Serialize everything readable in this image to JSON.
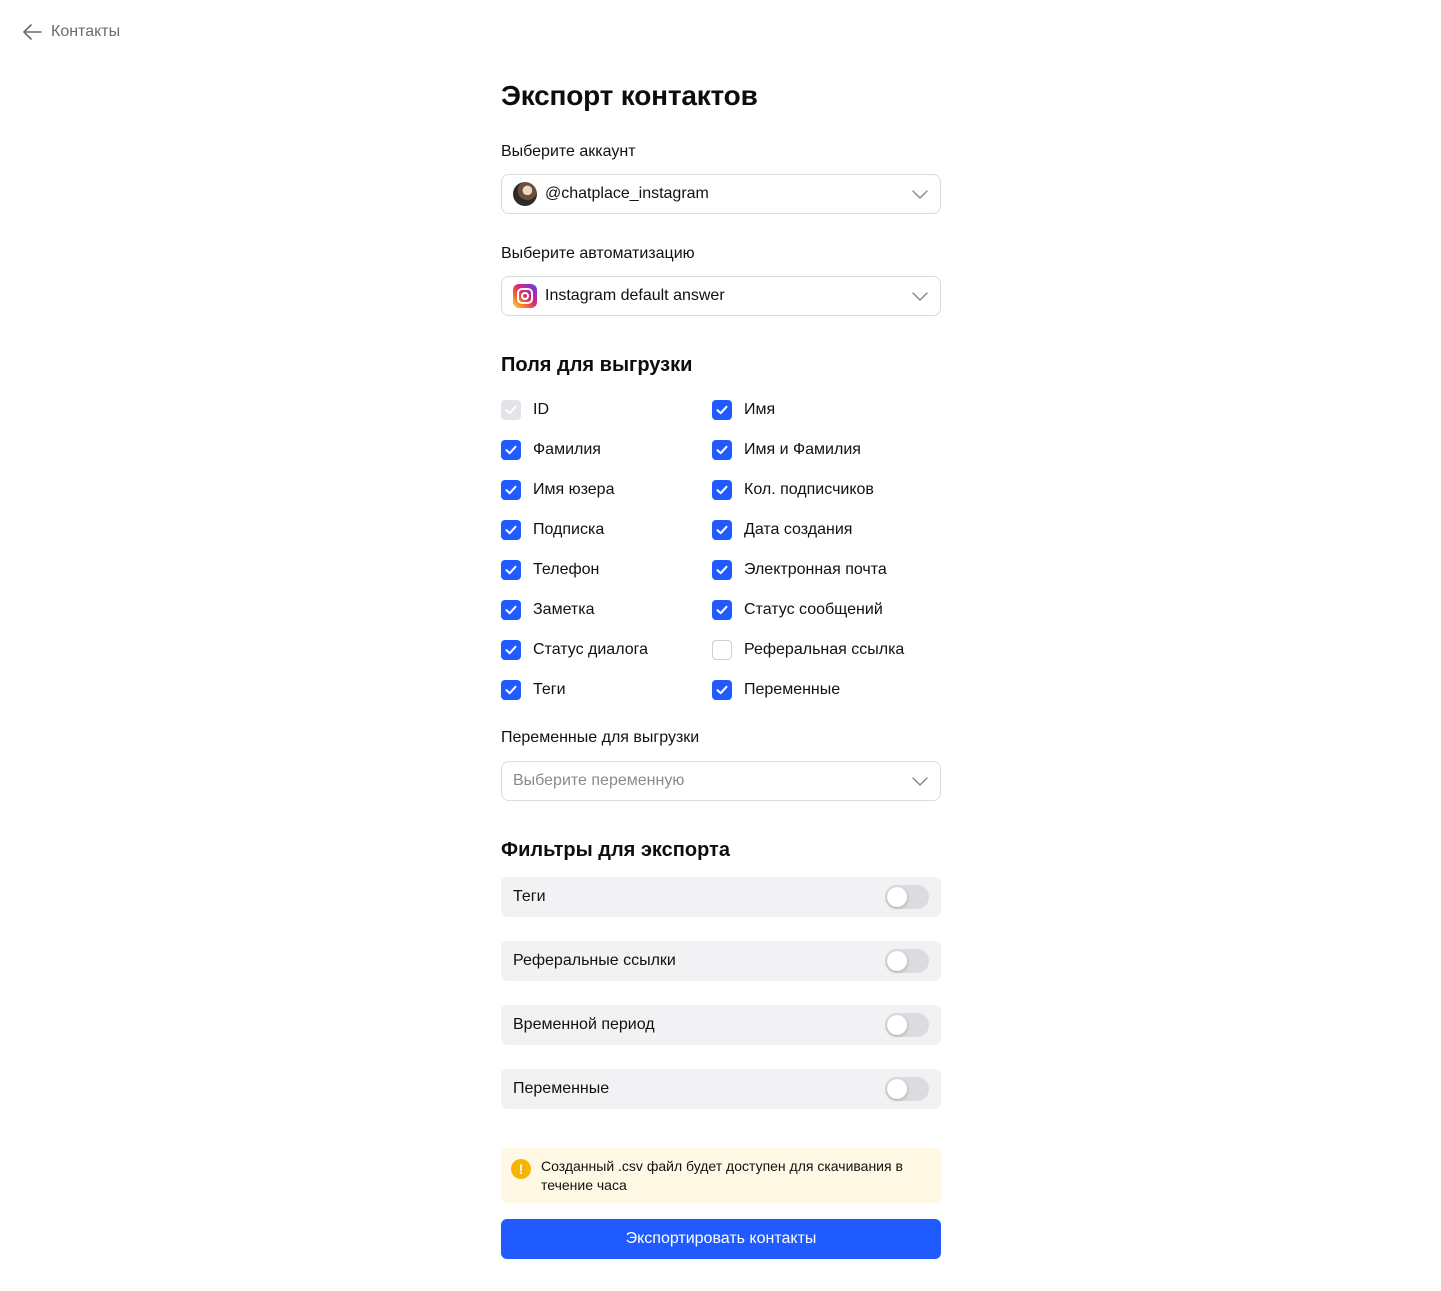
{
  "back": {
    "label": "Контакты",
    "icon": "arrow-left-icon"
  },
  "title": "Экспорт контактов",
  "account": {
    "label": "Выберите аккаунт",
    "value": "@chatplace_instagram",
    "icon": "avatar"
  },
  "automation": {
    "label": "Выберите автоматизацию",
    "value": "Instagram default answer",
    "icon": "instagram-icon"
  },
  "fields": {
    "title": "Поля для выгрузки",
    "items": [
      {
        "label": "ID",
        "state": "disabled"
      },
      {
        "label": "Имя",
        "state": "checked"
      },
      {
        "label": "Фамилия",
        "state": "checked"
      },
      {
        "label": "Имя и Фамилия",
        "state": "checked"
      },
      {
        "label": "Имя юзера",
        "state": "checked"
      },
      {
        "label": "Кол. подписчиков",
        "state": "checked"
      },
      {
        "label": "Подписка",
        "state": "checked"
      },
      {
        "label": "Дата создания",
        "state": "checked"
      },
      {
        "label": "Телефон",
        "state": "checked"
      },
      {
        "label": "Электронная почта",
        "state": "checked"
      },
      {
        "label": "Заметка",
        "state": "checked"
      },
      {
        "label": "Статус сообщений",
        "state": "checked"
      },
      {
        "label": "Статус диалога",
        "state": "checked"
      },
      {
        "label": "Реферальная ссылка",
        "state": "unchecked"
      },
      {
        "label": "Теги",
        "state": "checked"
      },
      {
        "label": "Переменные",
        "state": "checked"
      }
    ]
  },
  "variables": {
    "label": "Переменные для выгрузки",
    "placeholder": "Выберите переменную"
  },
  "filters": {
    "title": "Фильтры для экспорта",
    "items": [
      {
        "label": "Теги",
        "enabled": false
      },
      {
        "label": "Реферальные ссылки",
        "enabled": false
      },
      {
        "label": "Временной период",
        "enabled": false
      },
      {
        "label": "Переменные",
        "enabled": false
      }
    ]
  },
  "notice": {
    "icon": "!",
    "text": "Созданный .csv файл будет доступен для скачивания в течение часа"
  },
  "export_button": "Экспортировать контакты",
  "colors": {
    "accent": "#1f5bff",
    "checkbox_disabled": "#e4e4e8",
    "notice_bg": "#fff8e5",
    "notice_icon": "#f5b400",
    "filter_bg": "#f2f2f5"
  }
}
